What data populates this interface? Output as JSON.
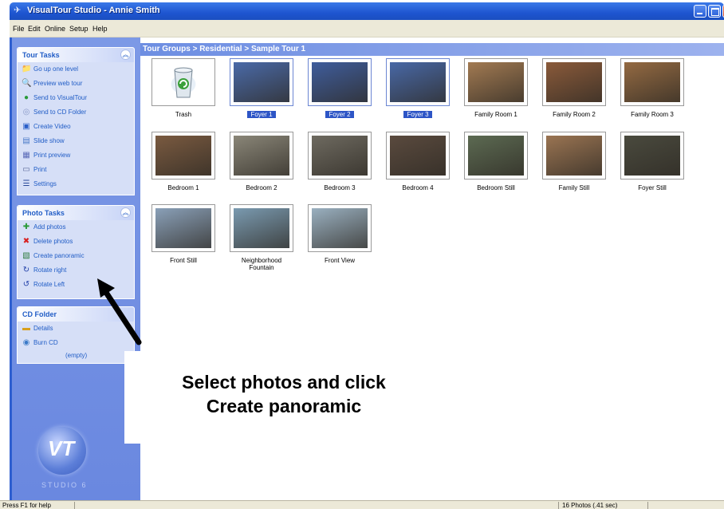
{
  "window": {
    "title": "VisualTour Studio - Annie Smith"
  },
  "menu": [
    "File",
    "Edit",
    "Online",
    "Setup",
    "Help"
  ],
  "sidebar": {
    "tour_tasks": {
      "title": "Tour Tasks",
      "items": [
        {
          "label": "Go up one level",
          "icon": "folder-up-icon",
          "color": "#d89a1e"
        },
        {
          "label": "Preview web tour",
          "icon": "magnifier-icon",
          "color": "#1f58b8"
        },
        {
          "label": "Send to VisualTour",
          "icon": "globe-icon",
          "color": "#2a9a3a"
        },
        {
          "label": "Send to CD Folder",
          "icon": "cd-icon",
          "color": "#8a9ac8"
        },
        {
          "label": "Create Video",
          "icon": "video-icon",
          "color": "#2a5fc8"
        },
        {
          "label": "Slide show",
          "icon": "slideshow-icon",
          "color": "#4a7ac8"
        },
        {
          "label": "Print preview",
          "icon": "print-preview-icon",
          "color": "#5a6ab8"
        },
        {
          "label": "Print",
          "icon": "printer-icon",
          "color": "#5a6a9a"
        },
        {
          "label": "Settings",
          "icon": "settings-list-icon",
          "color": "#2a4a9a"
        }
      ]
    },
    "photo_tasks": {
      "title": "Photo Tasks",
      "items": [
        {
          "label": "Add photos",
          "icon": "plus-icon",
          "color": "#2a9a3a"
        },
        {
          "label": "Delete photos",
          "icon": "delete-x-icon",
          "color": "#d82020"
        },
        {
          "label": "Create panoramic",
          "icon": "panoramic-icon",
          "color": "#2a7a3a"
        },
        {
          "label": "Rotate right",
          "icon": "rotate-right-icon",
          "color": "#1f3fa8"
        },
        {
          "label": "Rotate Left",
          "icon": "rotate-left-icon",
          "color": "#1f3fa8"
        }
      ]
    },
    "cd_folder": {
      "title": "CD Folder",
      "items": [
        {
          "label": "Details",
          "icon": "folder-icon",
          "color": "#d8a01e"
        },
        {
          "label": "Burn CD",
          "icon": "burn-cd-icon",
          "color": "#3a7ac8"
        }
      ],
      "empty_note": "(empty)"
    },
    "logo_text": "STUDIO 6"
  },
  "breadcrumb": "Tour Groups > Residential > Sample Tour 1",
  "photos": [
    {
      "label": "Trash",
      "selected": false,
      "color": "#ffffff",
      "kind": "trash"
    },
    {
      "label": "Foyer 1",
      "selected": true,
      "color": "#4a6aa8",
      "kind": "photo"
    },
    {
      "label": "Foyer 2",
      "selected": true,
      "color": "#3f5d9c",
      "kind": "photo"
    },
    {
      "label": "Foyer 3",
      "selected": true,
      "color": "#4868a6",
      "kind": "photo"
    },
    {
      "label": "Family Room 1",
      "selected": false,
      "color": "#a27a52",
      "kind": "photo"
    },
    {
      "label": "Family Room 2",
      "selected": false,
      "color": "#8a5a3a",
      "kind": "photo"
    },
    {
      "label": "Family Room 3",
      "selected": false,
      "color": "#946a42",
      "kind": "photo"
    },
    {
      "label": "Bedroom 1",
      "selected": false,
      "color": "#7a5a40",
      "kind": "photo"
    },
    {
      "label": "Bedroom 2",
      "selected": false,
      "color": "#8a8678",
      "kind": "photo"
    },
    {
      "label": "Bedroom 3",
      "selected": false,
      "color": "#6e6a60",
      "kind": "photo"
    },
    {
      "label": "Bedroom 4",
      "selected": false,
      "color": "#5a4a3e",
      "kind": "photo"
    },
    {
      "label": "Bedroom Still",
      "selected": false,
      "color": "#5c6a52",
      "kind": "photo"
    },
    {
      "label": "Family Still",
      "selected": false,
      "color": "#9a7452",
      "kind": "photo"
    },
    {
      "label": "Foyer Still",
      "selected": false,
      "color": "#4a4a3e",
      "kind": "photo"
    },
    {
      "label": "Front Still",
      "selected": false,
      "color": "#8aa0b8",
      "kind": "photo"
    },
    {
      "label": "Neighborhood Fountain",
      "selected": false,
      "color": "#7a9ab0",
      "kind": "photo"
    },
    {
      "label": "Front View",
      "selected": false,
      "color": "#9ab0c0",
      "kind": "photo"
    }
  ],
  "annotation": {
    "line1": "Select photos and click",
    "line2": "Create panoramic"
  },
  "status": {
    "help": "Press F1 for help",
    "count": "16 Photos (.41 sec)"
  },
  "colors": {
    "titlebar": "#2458d4",
    "sidebar": "#7290e4",
    "breadcrumb": "#7d9ae6",
    "selection": "#2d55c6"
  }
}
